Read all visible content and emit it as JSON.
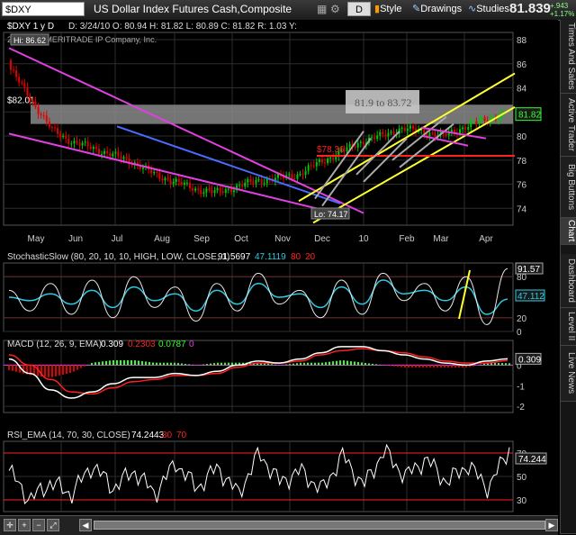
{
  "toolbar": {
    "symbol": "$DXY",
    "title": "US Dollar Index Futures Cash,Composite",
    "period": "D",
    "style_label": "Style",
    "drawings_label": "Drawings",
    "studies_label": "Studies",
    "last_price": "81.839",
    "change_up": "+.943",
    "change_pct": "+1.17%"
  },
  "side_tabs": [
    "Times And Sales",
    "Active Trader",
    "Big Buttons",
    "Chart",
    "Dashboard",
    "Level II",
    "Live News"
  ],
  "price_panel": {
    "header": "$DXY 1 y D",
    "ohlc": "D: 3/24/10  O: 80.94  H: 81.82  L: 80.89  C: 81.82  R: 1.03  Y:",
    "copyright": "2010 TD AMERITRADE IP Company, Inc.",
    "high_label": "Hi: 86.62",
    "low_label": "Lo: 74.17",
    "level_label": "$82.01",
    "level2_label": "$78.36",
    "zone_label": "81.9 to 83.72",
    "price_tag": "81.82",
    "yticks": [
      "88",
      "86",
      "84",
      "82",
      "80",
      "78",
      "76",
      "74"
    ],
    "xticks": [
      "May",
      "Jun",
      "Jul",
      "Aug",
      "Sep",
      "Oct",
      "Nov",
      "Dec",
      "10",
      "Feb",
      "Mar",
      "Apr"
    ]
  },
  "stoch_panel": {
    "label": "StochasticSlow (80, 20, 10, 10, HIGH, LOW, CLOSE, 1)",
    "val1": "91.5697",
    "val2": "47.1119",
    "ob": "80",
    "os": "20",
    "tag1": "91.57",
    "tag2": "47.112",
    "yticks": [
      "80",
      "20",
      "0"
    ]
  },
  "macd_panel": {
    "label": "MACD (12, 26, 9, EMA)",
    "val1": "0.309",
    "val2": "0.2303",
    "val3": "0.0787",
    "val4": "0",
    "tag": "0.309",
    "yticks": [
      "0",
      "-1",
      "-2"
    ]
  },
  "rsi_panel": {
    "label": "RSI_EMA (14, 70, 30, CLOSE)",
    "val1": "74.2443",
    "ob": "30",
    "os": "70",
    "tag": "74.244",
    "yticks": [
      "70",
      "50",
      "30"
    ]
  },
  "colors": {
    "grid": "#2e2e2e",
    "panel_bg": "#000000",
    "candle_up": "#00c800",
    "candle_down": "#e00000",
    "magenta": "#e040e0",
    "blue": "#4a6cff",
    "yellow": "#ffff30",
    "red_line": "#ff2020",
    "cyan": "#30c8e0",
    "white": "#ffffff",
    "green": "#30ff30"
  },
  "chart_data": [
    {
      "type": "candlestick",
      "title": "$DXY 1 y D",
      "categories": [
        "May",
        "Jun",
        "Jul",
        "Aug",
        "Sep",
        "Oct",
        "Nov",
        "Dec",
        "10",
        "Feb",
        "Mar",
        "Apr"
      ],
      "series": [
        {
          "name": "Close",
          "values": [
            85.5,
            83.0,
            80.5,
            79.5,
            79.0,
            78.4,
            77.8,
            76.8,
            76.2,
            75.6,
            75.3,
            75.8,
            76.3,
            76.5,
            76.8,
            77.8,
            78.6,
            79.5,
            80.0,
            80.6,
            80.4,
            80.0,
            80.7,
            81.3,
            81.82
          ]
        }
      ],
      "hi": 86.62,
      "lo": 74.17,
      "last": 81.82,
      "ylim": [
        72.6,
        88.6
      ],
      "annotations": [
        "$82.01",
        "$78.36",
        "81.9 to 83.72"
      ]
    },
    {
      "type": "line",
      "title": "StochasticSlow (80, 20, 10, 10, HIGH, LOW, CLOSE, 1)",
      "series": [
        {
          "values": [
            60,
            30,
            70,
            25,
            75,
            20,
            80,
            35,
            65,
            15,
            70,
            30,
            85,
            40,
            60,
            20,
            75,
            25,
            85,
            45,
            70,
            30,
            80,
            10,
            91.57
          ]
        },
        {
          "values": [
            50,
            45,
            55,
            40,
            60,
            35,
            65,
            45,
            55,
            30,
            60,
            40,
            70,
            50,
            55,
            35,
            65,
            40,
            75,
            55,
            60,
            45,
            65,
            25,
            47.11
          ]
        }
      ],
      "ylim": [
        0,
        100
      ]
    },
    {
      "type": "line",
      "title": "MACD (12, 26, 9, EMA)",
      "series": [
        {
          "values": [
            0.3,
            -0.4,
            -1.2,
            -1.6,
            -1.3,
            -0.9,
            -0.6,
            -0.6,
            -0.4,
            -0.5,
            -0.3,
            0.0,
            0.2,
            0.1,
            0.3,
            0.6,
            0.9,
            0.9,
            0.7,
            0.5,
            0.3,
            0.1,
            0.0,
            0.2,
            0.309
          ]
        },
        {
          "values": [
            0.5,
            0.0,
            -0.7,
            -1.3,
            -1.4,
            -1.1,
            -0.8,
            -0.7,
            -0.5,
            -0.5,
            -0.4,
            -0.1,
            0.1,
            0.1,
            0.2,
            0.5,
            0.7,
            0.8,
            0.7,
            0.6,
            0.4,
            0.2,
            0.1,
            0.1,
            0.2303
          ]
        }
      ],
      "ylim": [
        -2.3,
        1.2
      ]
    },
    {
      "type": "line",
      "title": "RSI_EMA (14, 70, 30, CLOSE)",
      "series": [
        {
          "values": [
            55,
            30,
            45,
            35,
            60,
            40,
            55,
            35,
            62,
            40,
            58,
            35,
            70,
            45,
            55,
            38,
            68,
            42,
            72,
            50,
            65,
            45,
            60,
            40,
            74.24
          ]
        }
      ],
      "ylim": [
        20,
        80
      ]
    }
  ]
}
